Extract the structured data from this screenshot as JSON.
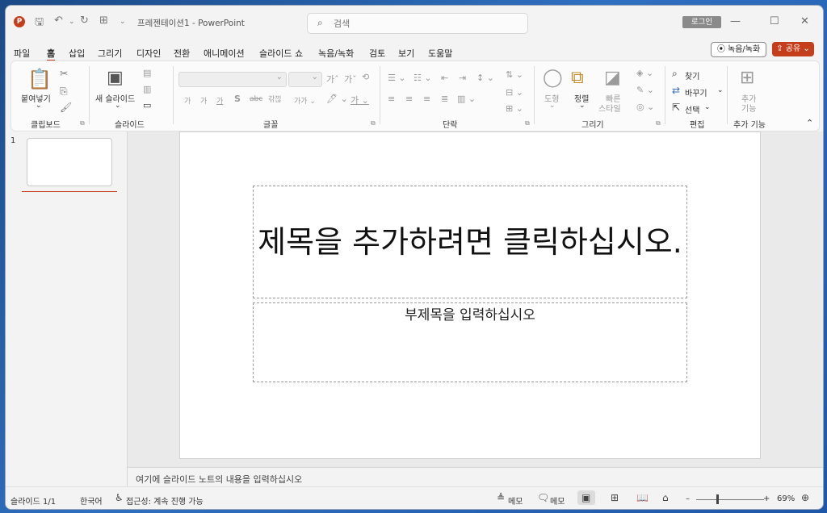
{
  "window": {
    "doc_title": "프레젠테이션1  -  PowerPoint",
    "search_placeholder": "검색",
    "login_label": "로그인",
    "app_icon_letter": "P"
  },
  "menu": {
    "tabs": [
      "파일",
      "홈",
      "삽입",
      "그리기",
      "디자인",
      "전환",
      "애니메이션",
      "슬라이드 쇼",
      "녹음/녹화",
      "검토",
      "보기",
      "도움말"
    ],
    "active_tab": "홈",
    "record_label": "녹음/녹화",
    "share_label": "공유"
  },
  "ribbon": {
    "groups": [
      "클립보드",
      "슬라이드",
      "글꼴",
      "단락",
      "그리기",
      "편집",
      "추가 기능"
    ],
    "paste_label": "붙여넣기",
    "new_slide_label": "새 슬라이드",
    "shape_label": "도형",
    "arrange_label": "정렬",
    "quick_style_label_1": "빠른",
    "quick_style_label_2": "스타일",
    "find_label": "찾기",
    "replace_label": "바꾸기",
    "select_label": "선택",
    "addin_label_1": "추가",
    "addin_label_2": "기능"
  },
  "thumbnails": {
    "slide_number": "1"
  },
  "slide": {
    "title_placeholder": "제목을 추가하려면 클릭하십시오.",
    "subtitle_placeholder": "부제목을 입력하십시오"
  },
  "notes": {
    "placeholder": "여기에 슬라이드 노트의 내용을 입력하십시오"
  },
  "status": {
    "slide_counter": "슬라이드 1/1",
    "language": "한국어",
    "accessibility": "접근성: 계속 진행 가능",
    "notes_btn": "메모",
    "comments_btn": "메모",
    "zoom_minus": "–",
    "zoom_plus": "+",
    "zoom_level": "69%",
    "zoom_fraction": 0.69
  },
  "colors": {
    "accent": "#c43e1c",
    "login_bg": "#8a8a8a"
  }
}
